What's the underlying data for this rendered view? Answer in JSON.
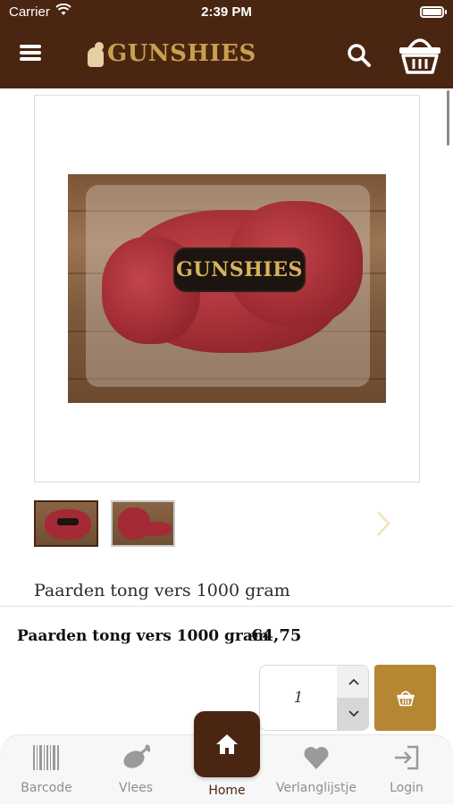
{
  "status_bar": {
    "carrier": "Carrier",
    "time": "2:39 PM"
  },
  "header": {
    "logo_text": "GUNSHIES",
    "icons": [
      "menu-icon",
      "search-icon",
      "basket-icon"
    ]
  },
  "product": {
    "image_badge_text": "GUNSHIES",
    "thumbnail_count": 2,
    "title": "Paarden tong vers 1000 gram"
  },
  "price_bar": {
    "name": "Paarden tong vers 1000 gram",
    "price": "€4,75",
    "quantity": "1"
  },
  "tabbar": {
    "tabs": [
      {
        "label": "Barcode",
        "icon": "barcode-icon"
      },
      {
        "label": "Vlees",
        "icon": "meat-icon"
      },
      {
        "label": "Home",
        "icon": "home-icon"
      },
      {
        "label": "Verlanglijstje",
        "icon": "heart-icon"
      },
      {
        "label": "Login",
        "icon": "login-icon"
      }
    ]
  },
  "colors": {
    "header_bg": "#4a2511",
    "accent_gold": "#b58732",
    "tab_inactive": "#8e8e8e"
  }
}
